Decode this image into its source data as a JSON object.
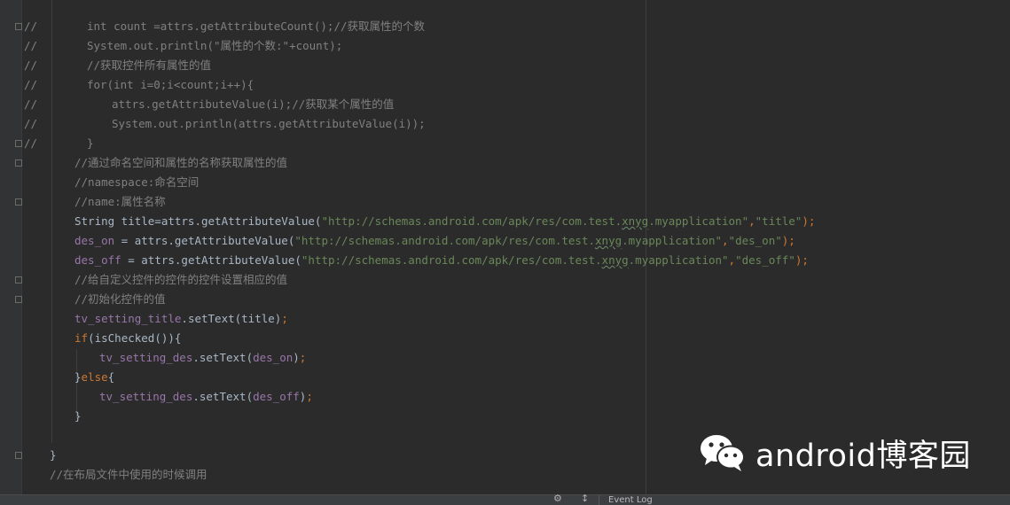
{
  "editor": {
    "lines": [
      {
        "mark": "//",
        "indent": 98,
        "segs": [
          {
            "t": "int count =attrs.getAttributeCount();//获取属性的个数",
            "c": "cm"
          }
        ]
      },
      {
        "mark": "//",
        "indent": 98,
        "segs": [
          {
            "t": "System.out.println(\"属性的个数:\"+count);",
            "c": "cm"
          }
        ]
      },
      {
        "mark": "//",
        "indent": 98,
        "segs": [
          {
            "t": "//获取控件所有属性的值",
            "c": "cm"
          }
        ]
      },
      {
        "mark": "//",
        "indent": 98,
        "segs": [
          {
            "t": "for(int i=0;i<count;i++){",
            "c": "cm"
          }
        ]
      },
      {
        "mark": "//",
        "indent": 126,
        "segs": [
          {
            "t": "attrs.getAttributeValue(i);//获取某个属性的值",
            "c": "cm"
          }
        ]
      },
      {
        "mark": "//",
        "indent": 126,
        "segs": [
          {
            "t": "System.out.println(attrs.getAttributeValue(i));",
            "c": "cm"
          }
        ]
      },
      {
        "mark": "//",
        "indent": 98,
        "segs": [
          {
            "t": "}",
            "c": "cm"
          }
        ]
      },
      {
        "mark": "",
        "indent": 84,
        "segs": [
          {
            "t": "//通过命名空间和属性的名称获取属性的值",
            "c": "cm"
          }
        ]
      },
      {
        "mark": "",
        "indent": 84,
        "segs": [
          {
            "t": "//namespace:命名空间",
            "c": "cm"
          }
        ]
      },
      {
        "mark": "",
        "indent": 84,
        "segs": [
          {
            "t": "//name:属性名称",
            "c": "cm"
          }
        ]
      },
      {
        "mark": "",
        "indent": 84,
        "segs": [
          {
            "t": "String title=attrs.getAttributeValue(",
            "c": "txt"
          },
          {
            "t": "\"http://schemas.android.com/apk/res/com.test.",
            "c": "str"
          },
          {
            "t": "xnyg",
            "c": "str sq"
          },
          {
            "t": ".myapplication\"",
            "c": "str"
          },
          {
            "t": ",",
            "c": "kw"
          },
          {
            "t": "\"title\"",
            "c": "str"
          },
          {
            "t": ");",
            "c": "kw"
          }
        ]
      },
      {
        "mark": "",
        "indent": 84,
        "segs": [
          {
            "t": "des_on",
            "c": "fld"
          },
          {
            "t": " = attrs.getAttributeValue(",
            "c": "txt"
          },
          {
            "t": "\"http://schemas.android.com/apk/res/com.test.",
            "c": "str"
          },
          {
            "t": "xnyg",
            "c": "str sq"
          },
          {
            "t": ".myapplication\"",
            "c": "str"
          },
          {
            "t": ",",
            "c": "kw"
          },
          {
            "t": "\"des_on\"",
            "c": "str"
          },
          {
            "t": ");",
            "c": "kw"
          }
        ]
      },
      {
        "mark": "",
        "indent": 84,
        "segs": [
          {
            "t": "des_off",
            "c": "fld"
          },
          {
            "t": " = attrs.getAttributeValue(",
            "c": "txt"
          },
          {
            "t": "\"http://schemas.android.com/apk/res/com.test.",
            "c": "str"
          },
          {
            "t": "xnyg",
            "c": "str sq"
          },
          {
            "t": ".myapplication\"",
            "c": "str"
          },
          {
            "t": ",",
            "c": "kw"
          },
          {
            "t": "\"des_off\"",
            "c": "str"
          },
          {
            "t": ");",
            "c": "kw"
          }
        ]
      },
      {
        "mark": "",
        "indent": 84,
        "segs": [
          {
            "t": "//给自定义控件的控件的控件设置相应的值",
            "c": "cm"
          }
        ]
      },
      {
        "mark": "",
        "indent": 84,
        "segs": [
          {
            "t": "//初始化控件的值",
            "c": "cm"
          }
        ]
      },
      {
        "mark": "",
        "indent": 84,
        "segs": [
          {
            "t": "tv_setting_title",
            "c": "fld"
          },
          {
            "t": ".setText(title)",
            "c": "txt"
          },
          {
            "t": ";",
            "c": "kw"
          }
        ]
      },
      {
        "mark": "",
        "indent": 84,
        "segs": [
          {
            "t": "if",
            "c": "kw"
          },
          {
            "t": "(isChecked()){",
            "c": "txt"
          }
        ]
      },
      {
        "mark": "",
        "indent": 112,
        "segs": [
          {
            "t": "tv_setting_des",
            "c": "fld"
          },
          {
            "t": ".setText(",
            "c": "txt"
          },
          {
            "t": "des_on",
            "c": "fld"
          },
          {
            "t": ")",
            "c": "txt"
          },
          {
            "t": ";",
            "c": "kw"
          }
        ]
      },
      {
        "mark": "",
        "indent": 84,
        "segs": [
          {
            "t": "}",
            "c": "txt"
          },
          {
            "t": "else",
            "c": "kw"
          },
          {
            "t": "{",
            "c": "txt"
          }
        ]
      },
      {
        "mark": "",
        "indent": 112,
        "segs": [
          {
            "t": "tv_setting_des",
            "c": "fld"
          },
          {
            "t": ".setText(",
            "c": "txt"
          },
          {
            "t": "des_off",
            "c": "fld"
          },
          {
            "t": ")",
            "c": "txt"
          },
          {
            "t": ";",
            "c": "kw"
          }
        ]
      },
      {
        "mark": "",
        "indent": 84,
        "segs": [
          {
            "t": "}",
            "c": "txt"
          }
        ]
      },
      {
        "mark": "",
        "indent": 84,
        "segs": []
      },
      {
        "mark": "",
        "indent": 56,
        "segs": [
          {
            "t": "}",
            "c": "txt"
          }
        ]
      },
      {
        "mark": "",
        "indent": 56,
        "segs": [
          {
            "t": "//在布局文件中使用的时候调用",
            "c": "cm"
          }
        ]
      }
    ]
  },
  "watermark": {
    "text": "android博客园",
    "icon": "wechat-icon"
  },
  "statusbar": {
    "event_log_label": "Event Log",
    "settings_icon": "gear-icon",
    "extra_icon": "pin-icon"
  },
  "colors": {
    "background": "#2b2b2b",
    "comment": "#808080",
    "keyword": "#cc7832",
    "field": "#9876aa",
    "string": "#6a8759",
    "text": "#a9b7c6"
  }
}
